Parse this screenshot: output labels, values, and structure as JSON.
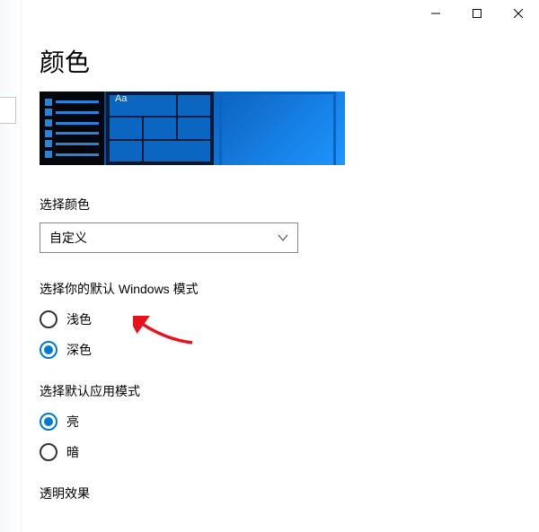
{
  "window": {
    "title": "颜色",
    "controls": {
      "minimize": "minimize",
      "maximize": "maximize",
      "close": "close"
    }
  },
  "preview": {
    "sample_text": "Aa"
  },
  "sections": {
    "choose_color": {
      "label": "选择颜色",
      "dropdown": {
        "selected": "自定义"
      }
    },
    "windows_mode": {
      "label": "选择你的默认 Windows 模式",
      "options": {
        "light": {
          "label": "浅色",
          "selected": false
        },
        "dark": {
          "label": "深色",
          "selected": true
        }
      }
    },
    "app_mode": {
      "label": "选择默认应用模式",
      "options": {
        "light": {
          "label": "亮",
          "selected": true
        },
        "dark": {
          "label": "暗",
          "selected": false
        }
      }
    },
    "transparency": {
      "label": "透明效果"
    }
  },
  "colors": {
    "accent": "#0078d4"
  },
  "annotation": {
    "arrow_target": "windows-mode-light"
  }
}
